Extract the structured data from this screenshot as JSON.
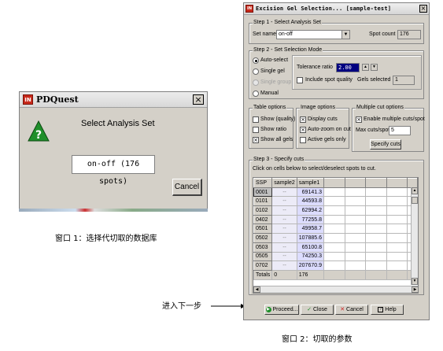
{
  "window1": {
    "title": "PDQuest",
    "message": "Select Analysis Set",
    "field_value": "on-off (176 spots)",
    "cancel_label": "Cancel",
    "app_icon_text": "IN",
    "icon": "question-icon",
    "colors": {
      "question_green": "#1f8f2a",
      "app_icon_red": "#c8291b"
    }
  },
  "caption1": "窗口 1：选择代切取的数据库",
  "window2": {
    "title": "Excision Gel Selection... [sample-test]",
    "app_icon_text": "IN",
    "step1": {
      "label": "Step 1 - Select Analysis Set",
      "set_name_label": "Set name",
      "set_name_value": "on-off",
      "spot_count_label": "Spot count",
      "spot_count_value": "176"
    },
    "step2": {
      "label": "Step 2 - Set Selection Mode",
      "modes": [
        "Auto-select",
        "Single gel",
        "Single group",
        "Manual"
      ],
      "tolerance_label": "Tolerance ratio",
      "tolerance_value": "2.00",
      "include_quality_label": "Include spot quality",
      "gels_selected_label": "Gels selected",
      "gels_selected_value": "1"
    },
    "table_options": {
      "label": "Table options",
      "items": [
        "Show (quality)",
        "Show ratio",
        "Show all gels"
      ]
    },
    "image_options": {
      "label": "Image options",
      "items": [
        "Display cuts",
        "Auto-zoom on cut",
        "Active gels only"
      ]
    },
    "multiple_cut_options": {
      "label": "Multiple cut options",
      "enable_label": "Enable multiple cuts/spot",
      "max_cuts_label": "Max cuts/spot",
      "max_cuts_value": "5",
      "specify_button": "Specify cuts"
    },
    "step3": {
      "label": "Step 3 - Specify cuts",
      "instruction": "Click on cells below to select/deselect spots to cut.",
      "columns": [
        "SSP",
        "sample2",
        "sample1"
      ],
      "rows": [
        {
          "ssp": "0001",
          "sample2": "--",
          "sample1": "69141.3"
        },
        {
          "ssp": "0101",
          "sample2": "--",
          "sample1": "44593.8"
        },
        {
          "ssp": "0102",
          "sample2": "--",
          "sample1": "62994.2"
        },
        {
          "ssp": "0402",
          "sample2": "--",
          "sample1": "77255.8"
        },
        {
          "ssp": "0501",
          "sample2": "--",
          "sample1": "49958.7"
        },
        {
          "ssp": "0502",
          "sample2": "--",
          "sample1": "107885.6"
        },
        {
          "ssp": "0503",
          "sample2": "--",
          "sample1": "65100.8"
        },
        {
          "ssp": "0505",
          "sample2": "--",
          "sample1": "74250.3"
        },
        {
          "ssp": "0702",
          "sample2": "--",
          "sample1": "207670.9"
        }
      ],
      "totals": {
        "label": "Totals",
        "sample2": "0",
        "sample1": "176"
      }
    },
    "buttons": {
      "proceed": "Proceed...",
      "close": "Close",
      "cancel": "Cancel",
      "help": "Help"
    }
  },
  "arrow_label": "进入下一步",
  "caption2": "窗口 2：切取的参数"
}
